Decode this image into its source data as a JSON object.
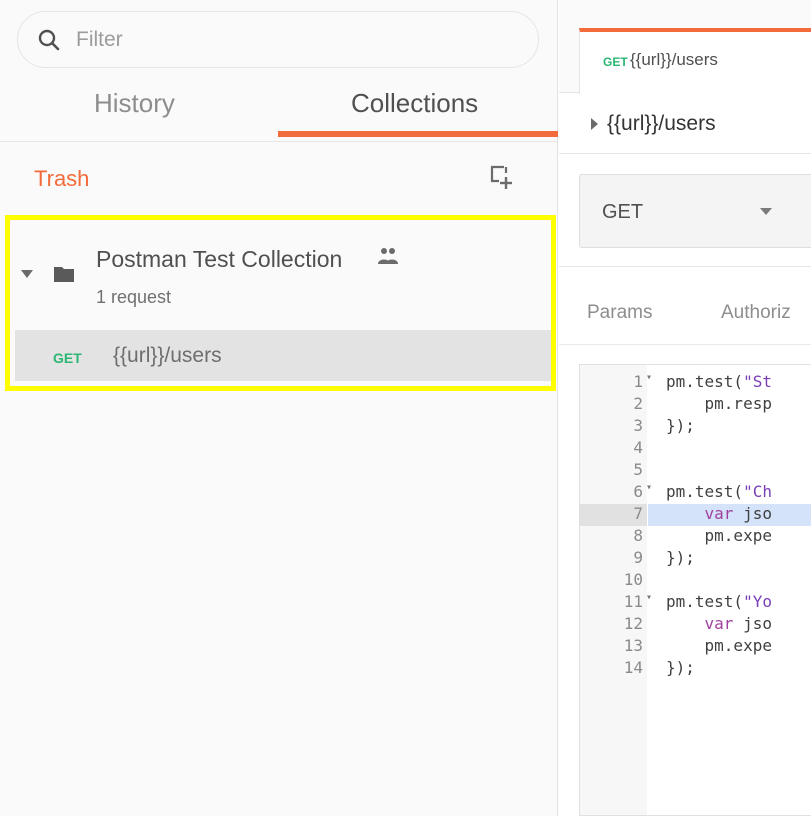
{
  "sidebar": {
    "filter": {
      "placeholder": "Filter"
    },
    "tabs": {
      "history": "History",
      "collections": "Collections"
    },
    "trash_label": "Trash",
    "collection": {
      "name": "Postman Test Collection",
      "count": "1 request",
      "requests": [
        {
          "method": "GET",
          "url": "{{url}}/users"
        }
      ]
    }
  },
  "main": {
    "tab": {
      "method": "GET",
      "title": "{{url}}/users"
    },
    "breadcrumb": "{{url}}/users",
    "method_select": "GET",
    "subtabs": {
      "params": "Params",
      "auth": "Authoriz"
    },
    "code_lines": [
      {
        "n": "1",
        "fold": "▾",
        "text": "pm.test(\"St"
      },
      {
        "n": "2",
        "fold": "",
        "text": "    pm.resp"
      },
      {
        "n": "3",
        "fold": "",
        "text": "});"
      },
      {
        "n": "4",
        "fold": "",
        "text": ""
      },
      {
        "n": "5",
        "fold": "",
        "text": ""
      },
      {
        "n": "6",
        "fold": "▾",
        "text": "pm.test(\"Ch"
      },
      {
        "n": "7",
        "fold": "",
        "text": "    var jso"
      },
      {
        "n": "8",
        "fold": "",
        "text": "    pm.expe"
      },
      {
        "n": "9",
        "fold": "",
        "text": "});"
      },
      {
        "n": "10",
        "fold": "",
        "text": ""
      },
      {
        "n": "11",
        "fold": "▾",
        "text": "pm.test(\"Yo"
      },
      {
        "n": "12",
        "fold": "",
        "text": "    var jso"
      },
      {
        "n": "13",
        "fold": "",
        "text": "    pm.expe"
      },
      {
        "n": "14",
        "fold": "",
        "text": "});"
      }
    ]
  },
  "colors": {
    "accent": "#f26b3a",
    "get_method": "#2bb673",
    "highlight_border": "#ffff00"
  }
}
